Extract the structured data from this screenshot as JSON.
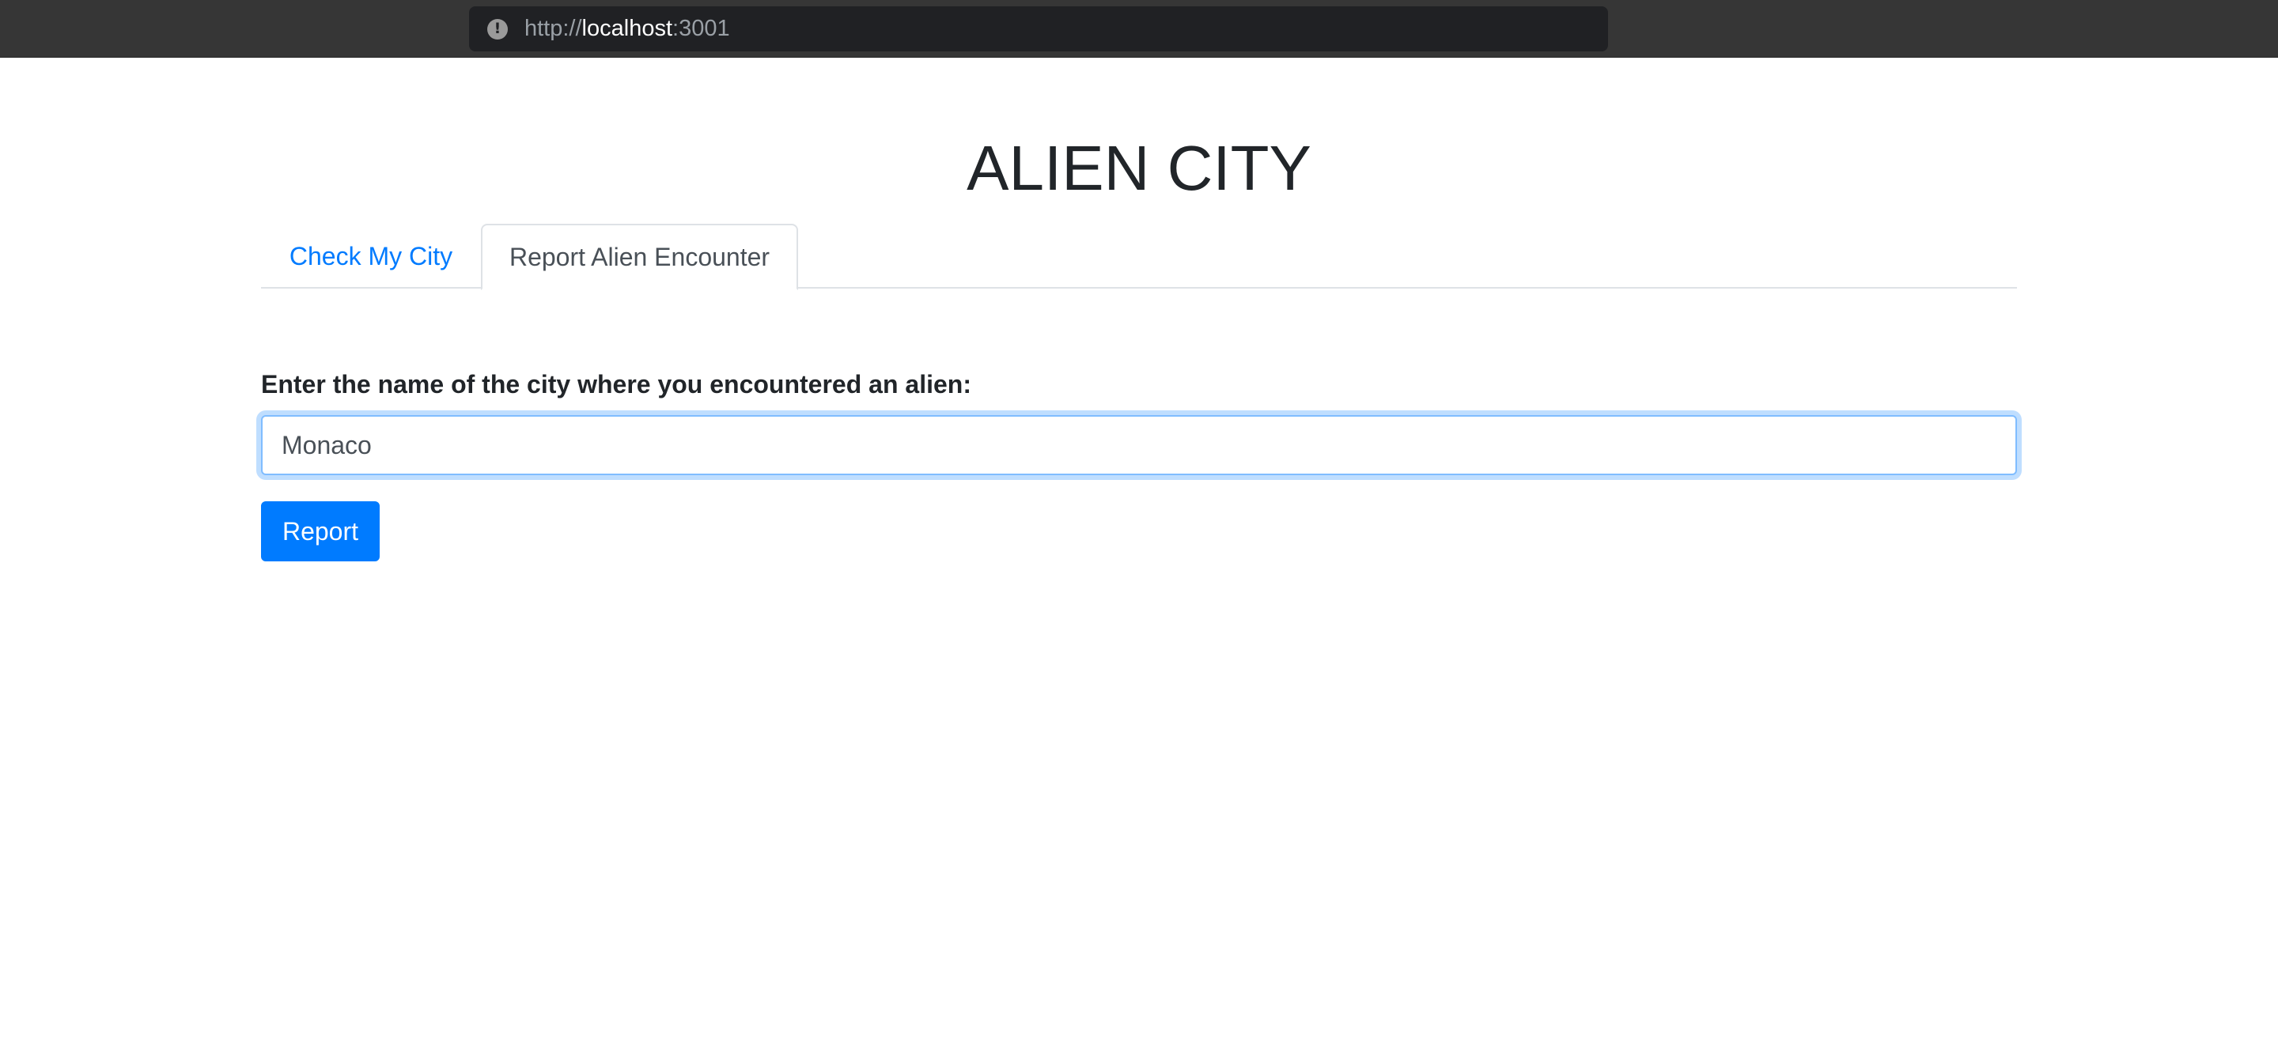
{
  "browser": {
    "url_scheme": "http://",
    "url_host": "localhost",
    "url_port": ":3001",
    "info_icon": "info-icon"
  },
  "app": {
    "title": "ALIEN CITY"
  },
  "tabs": [
    {
      "label": "Check My City",
      "active": false
    },
    {
      "label": "Report Alien Encounter",
      "active": true
    }
  ],
  "form": {
    "label": "Enter the name of the city where you encountered an alien:",
    "city_value": "Monaco",
    "submit_label": "Report"
  },
  "colors": {
    "accent": "#007bff",
    "browser_chrome": "#363636",
    "url_box": "#202124",
    "focus_border": "#80bdff"
  }
}
